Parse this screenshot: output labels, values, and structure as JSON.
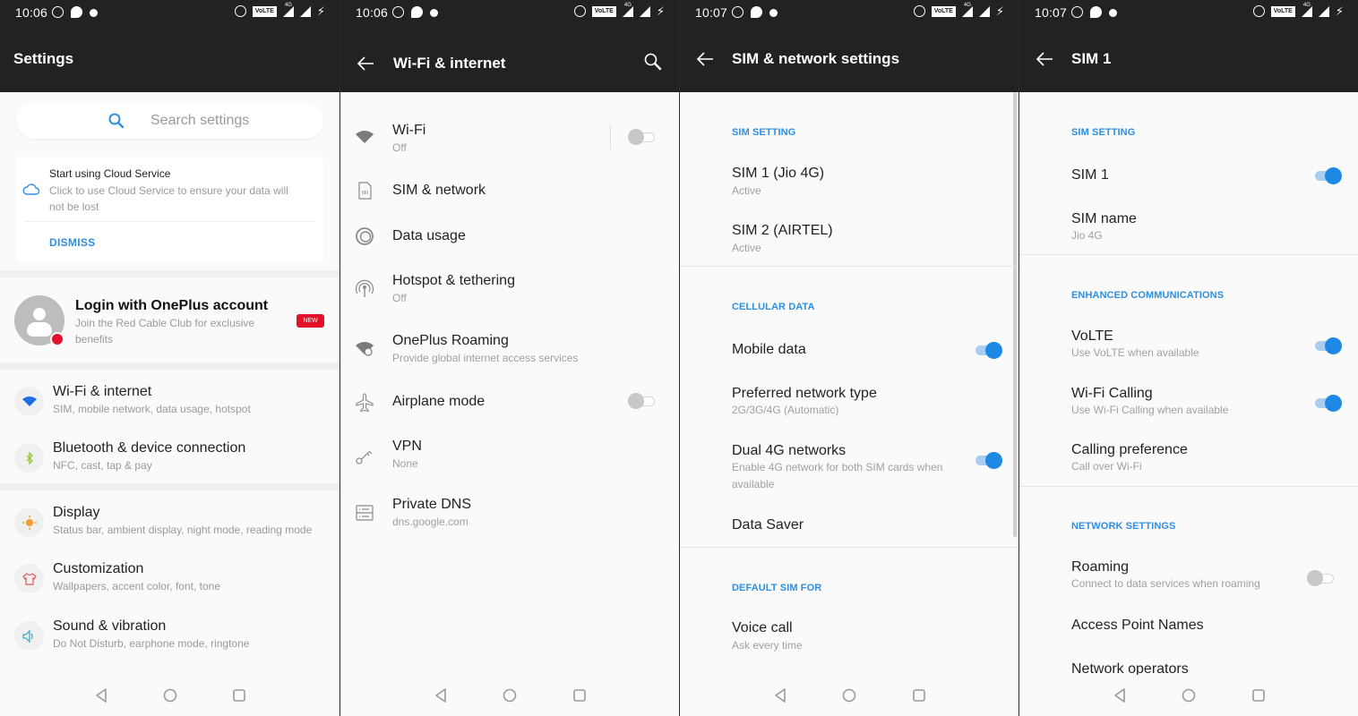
{
  "colors": {
    "accent": "#2f8fe0",
    "toggle_on": "#1e88e5",
    "topbar": "#222222",
    "badge_red": "#e3122a",
    "background": "#fafafa"
  },
  "status_bar": [
    {
      "time": "10:06",
      "volte_label": "VoLTE",
      "network_label": "4G"
    },
    {
      "time": "10:06",
      "volte_label": "VoLTE",
      "network_label": "4G"
    },
    {
      "time": "10:07",
      "volte_label": "VoLTE",
      "network_label": "4G"
    },
    {
      "time": "10:07",
      "volte_label": "VoLTE",
      "network_label": "4G"
    }
  ],
  "settings": {
    "title": "Settings",
    "search_placeholder": "Search settings",
    "cloud_card": {
      "title": "Start using Cloud Service",
      "subtitle": "Click to use Cloud Service to ensure your data will not be lost",
      "dismiss_label": "DISMISS"
    },
    "login": {
      "title": "Login with OnePlus account",
      "subtitle": "Join the Red Cable Club for exclusive benefits",
      "badge": "NEW"
    },
    "items": [
      {
        "icon": "wifi-icon",
        "title": "Wi-Fi & internet",
        "subtitle": "SIM, mobile network, data usage, hotspot"
      },
      {
        "icon": "bluetooth-icon",
        "title": "Bluetooth & device connection",
        "subtitle": "NFC, cast, tap & pay"
      },
      {
        "icon": "brightness-icon",
        "title": "Display",
        "subtitle": "Status bar, ambient display, night mode, reading mode"
      },
      {
        "icon": "tshirt-icon",
        "title": "Customization",
        "subtitle": "Wallpapers, accent color, font, tone"
      },
      {
        "icon": "speaker-icon",
        "title": "Sound & vibration",
        "subtitle": "Do Not Disturb, earphone mode, ringtone"
      }
    ]
  },
  "wifi_internet": {
    "title": "Wi-Fi & internet",
    "items": [
      {
        "icon": "wifi-icon",
        "title": "Wi-Fi",
        "subtitle": "Off",
        "toggle": false
      },
      {
        "icon": "sim-card-icon",
        "title": "SIM & network",
        "subtitle": ""
      },
      {
        "icon": "data-usage-icon",
        "title": "Data usage",
        "subtitle": ""
      },
      {
        "icon": "hotspot-icon",
        "title": "Hotspot & tethering",
        "subtitle": "Off"
      },
      {
        "icon": "roaming-icon",
        "title": "OnePlus Roaming",
        "subtitle": "Provide global internet access services"
      },
      {
        "icon": "airplane-icon",
        "title": "Airplane mode",
        "subtitle": "",
        "toggle": false
      },
      {
        "icon": "vpn-key-icon",
        "title": "VPN",
        "subtitle": "None"
      },
      {
        "icon": "dns-icon",
        "title": "Private DNS",
        "subtitle": "dns.google.com"
      }
    ]
  },
  "sim_network": {
    "title": "SIM & network settings",
    "sections": [
      {
        "header": "SIM SETTING",
        "items": [
          {
            "title": "SIM 1  (Jio 4G)",
            "subtitle": "Active"
          },
          {
            "title": "SIM 2  (AIRTEL)",
            "subtitle": "Active"
          }
        ]
      },
      {
        "header": "CELLULAR DATA",
        "items": [
          {
            "title": "Mobile data",
            "subtitle": "",
            "toggle": true
          },
          {
            "title": "Preferred network type",
            "subtitle": "2G/3G/4G (Automatic)"
          },
          {
            "title": "Dual 4G networks",
            "subtitle": "Enable 4G network for both SIM cards when available",
            "toggle": true
          },
          {
            "title": "Data Saver",
            "subtitle": ""
          }
        ]
      },
      {
        "header": "DEFAULT SIM FOR",
        "items": [
          {
            "title": "Voice call",
            "subtitle": "Ask every time"
          }
        ]
      }
    ]
  },
  "sim1": {
    "title": "SIM 1",
    "sections": [
      {
        "header": "SIM SETTING",
        "items": [
          {
            "title": "SIM 1",
            "subtitle": "",
            "toggle": true
          },
          {
            "title": "SIM name",
            "subtitle": "Jio 4G"
          }
        ]
      },
      {
        "header": "ENHANCED COMMUNICATIONS",
        "items": [
          {
            "title": "VoLTE",
            "subtitle": "Use VoLTE when available",
            "toggle": true
          },
          {
            "title": "Wi-Fi Calling",
            "subtitle": "Use Wi-Fi Calling when available",
            "toggle": true
          },
          {
            "title": "Calling preference",
            "subtitle": "Call over Wi-Fi"
          }
        ]
      },
      {
        "header": "NETWORK SETTINGS",
        "items": [
          {
            "title": "Roaming",
            "subtitle": "Connect to data services when roaming",
            "toggle": false
          },
          {
            "title": "Access Point Names",
            "subtitle": ""
          },
          {
            "title": "Network operators",
            "subtitle": ""
          }
        ]
      }
    ]
  },
  "nav_bar": {
    "back": "back-icon",
    "home": "home-icon",
    "recents": "recents-icon"
  }
}
